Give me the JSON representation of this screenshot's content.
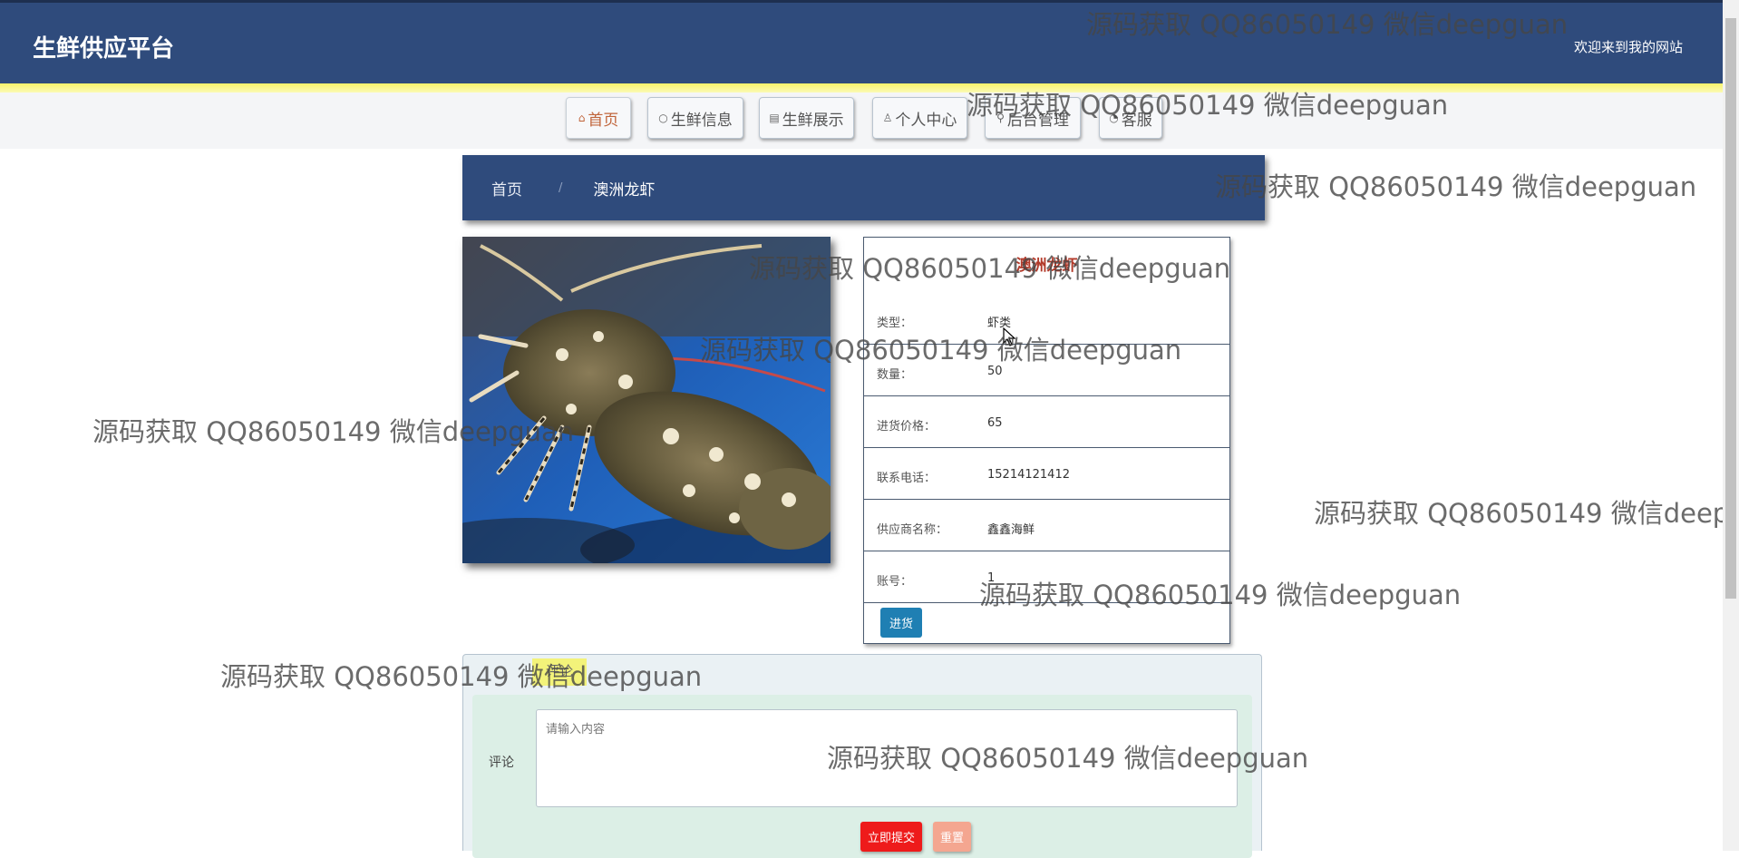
{
  "header": {
    "title": "生鲜供应平台",
    "welcome": "欢迎来到我的网站"
  },
  "nav": [
    {
      "label": "首页",
      "icon": "home-icon",
      "glyph": "⌂"
    },
    {
      "label": "生鲜信息",
      "icon": "circle-icon",
      "glyph": "○"
    },
    {
      "label": "生鲜展示",
      "icon": "document-icon",
      "glyph": "▤"
    },
    {
      "label": "个人中心",
      "icon": "user-icon",
      "glyph": "♙"
    },
    {
      "label": "后台管理",
      "icon": "link-icon",
      "glyph": "⚲"
    },
    {
      "label": "客服",
      "icon": "chat-icon",
      "glyph": "◔"
    }
  ],
  "breadcrumb": {
    "home": "首页",
    "separator": "/",
    "current": "澳洲龙虾"
  },
  "product": {
    "title": "澳洲龙虾",
    "fields": [
      {
        "label": "类型：",
        "value": "虾类"
      },
      {
        "label": "数量：",
        "value": "50"
      },
      {
        "label": "进货价格：",
        "value": "65"
      },
      {
        "label": "联系电话：",
        "value": "15214121412"
      },
      {
        "label": "供应商名称：",
        "value": "鑫鑫海鲜"
      },
      {
        "label": "账号：",
        "value": "1"
      }
    ],
    "buy_label": "进货"
  },
  "comment": {
    "tab_label": "评论",
    "field_label": "评论",
    "placeholder": "请输入内容",
    "submit_label": "立即提交",
    "reset_label": "重置"
  },
  "watermark": "源码获取 QQ86050149 微信deepguan",
  "colors": {
    "header_bg": "#2f4b7c",
    "accent_active": "#c0643a",
    "title_red": "#b23a2a",
    "buy_button": "#1f7fb3",
    "submit_button": "#ee1b1b",
    "reset_button": "#f4a690"
  }
}
